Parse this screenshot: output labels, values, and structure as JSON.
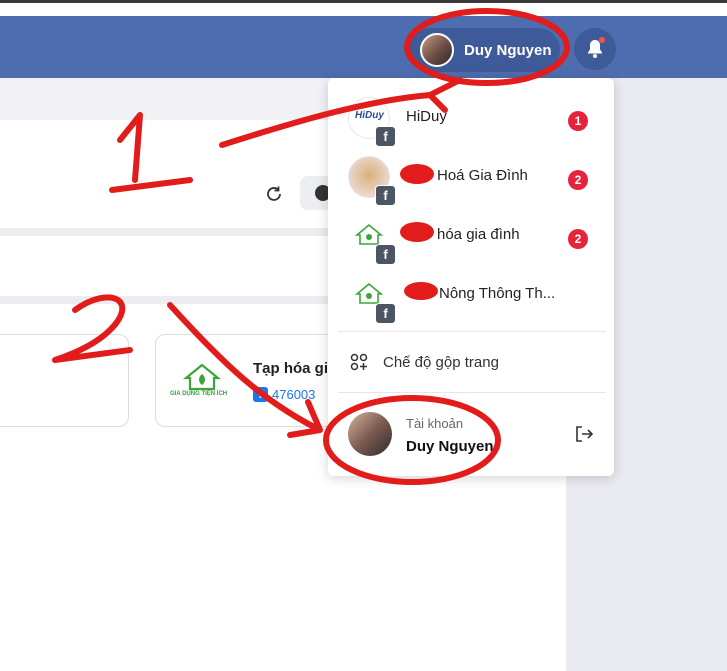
{
  "header": {
    "user_name": "Duy Nguyen"
  },
  "card": {
    "title": "Tạp hóa gia",
    "page_id": "476003"
  },
  "card_logo_caption": "GIA DỤNG TIỆN ÍCH",
  "dropdown": {
    "pages": [
      {
        "name": "HiDuy",
        "badge": "1",
        "avatar_text": "HiDuy"
      },
      {
        "name": "Hoá Gia Đình",
        "badge": "2"
      },
      {
        "name": "hóa gia đình",
        "badge": "2"
      },
      {
        "name": "Nông Thông Th...",
        "badge": ""
      }
    ],
    "merge_label": "Chế độ gộp trang",
    "account": {
      "label": "Tài khoản",
      "name": "Duy Nguyen"
    }
  },
  "annotations": {
    "step1": "1",
    "step2": "2",
    "color": "#e21b1b"
  },
  "colors": {
    "header": "#4e6db0",
    "pill": "#3f5a98",
    "badge": "#e5233a",
    "facebook": "#1877f2"
  }
}
